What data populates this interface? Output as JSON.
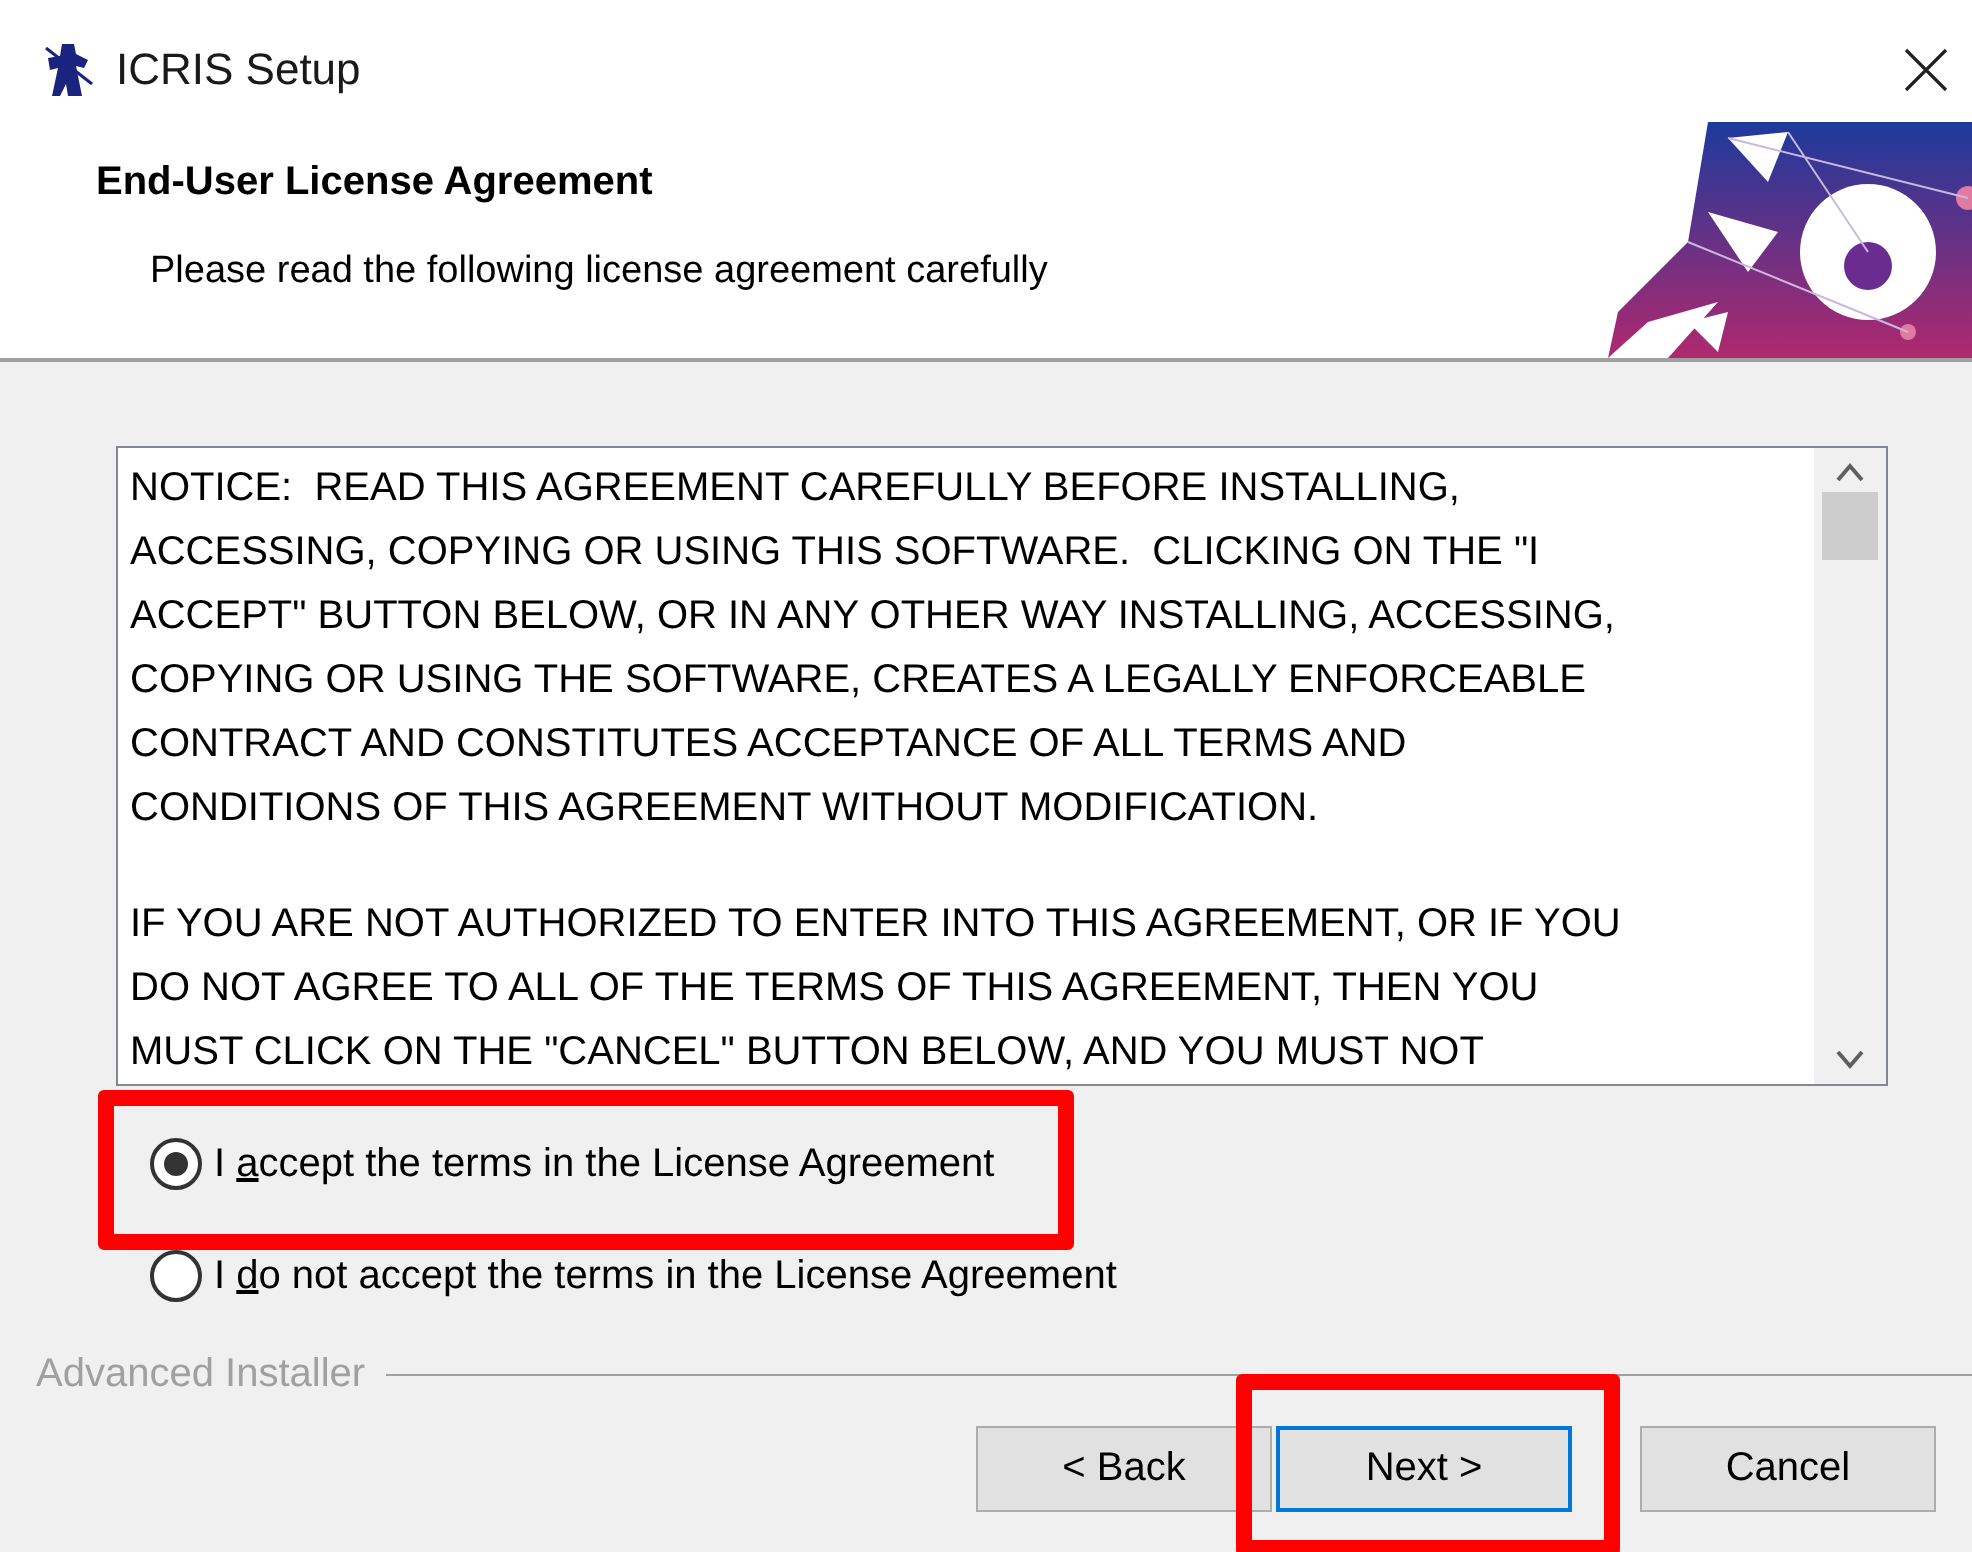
{
  "window": {
    "title": "ICRIS Setup"
  },
  "header": {
    "title": "End-User License Agreement",
    "subtitle": "Please read the following license agreement carefully"
  },
  "license": {
    "paragraphs": [
      "NOTICE:  READ THIS AGREEMENT CAREFULLY BEFORE INSTALLING,\nACCESSING, COPYING OR USING THIS SOFTWARE.  CLICKING ON THE \"I\nACCEPT\" BUTTON BELOW, OR IN ANY OTHER WAY INSTALLING, ACCESSING,\nCOPYING OR USING THE SOFTWARE, CREATES A LEGALLY ENFORCEABLE\nCONTRACT AND CONSTITUTES ACCEPTANCE OF ALL TERMS AND\nCONDITIONS OF THIS AGREEMENT WITHOUT MODIFICATION.",
      "IF YOU ARE NOT AUTHORIZED TO ENTER INTO THIS AGREEMENT, OR IF YOU\nDO NOT AGREE TO ALL OF THE TERMS OF THIS AGREEMENT, THEN YOU\nMUST CLICK ON THE \"CANCEL\" BUTTON BELOW, AND YOU MUST NOT"
    ]
  },
  "options": [
    {
      "label_start": "I ",
      "access_key": "a",
      "label_rest": "ccept the terms in the License Agreement",
      "selected": true,
      "highlighted": true
    },
    {
      "label_start": "I ",
      "access_key": "d",
      "label_rest": "o not accept the terms in the License Agreement",
      "selected": false,
      "highlighted": false
    }
  ],
  "footer": {
    "brand": "Advanced Installer"
  },
  "buttons": [
    {
      "label": "< Back",
      "default": false,
      "highlighted": false
    },
    {
      "label": "Next >",
      "default": true,
      "highlighted": true
    },
    {
      "label": "Cancel",
      "default": false,
      "highlighted": false
    }
  ]
}
